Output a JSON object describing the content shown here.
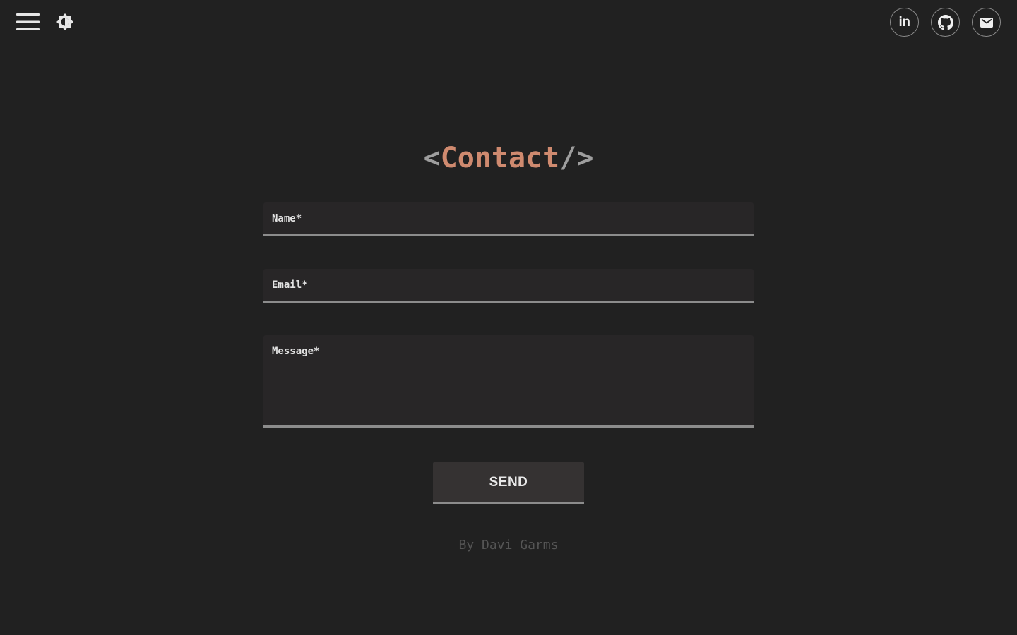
{
  "header": {
    "menu_icon": "hamburger-menu-icon",
    "theme_icon": "brightness-toggle-icon",
    "social": [
      {
        "name": "linkedin",
        "icon": "linkedin-icon",
        "label": "in"
      },
      {
        "name": "github",
        "icon": "github-icon"
      },
      {
        "name": "email",
        "icon": "mail-icon"
      }
    ]
  },
  "title": {
    "open": "<",
    "word": "Contact",
    "close": "/>"
  },
  "form": {
    "name_placeholder": "Name*",
    "email_placeholder": "Email*",
    "message_placeholder": "Message*",
    "send_label": "SEND"
  },
  "footer": {
    "credit": "By Davi Garms"
  },
  "colors": {
    "background": "#212121",
    "accent": "#cf8a6f",
    "field_bg": "#282627",
    "underline": "#8c8c8c"
  }
}
